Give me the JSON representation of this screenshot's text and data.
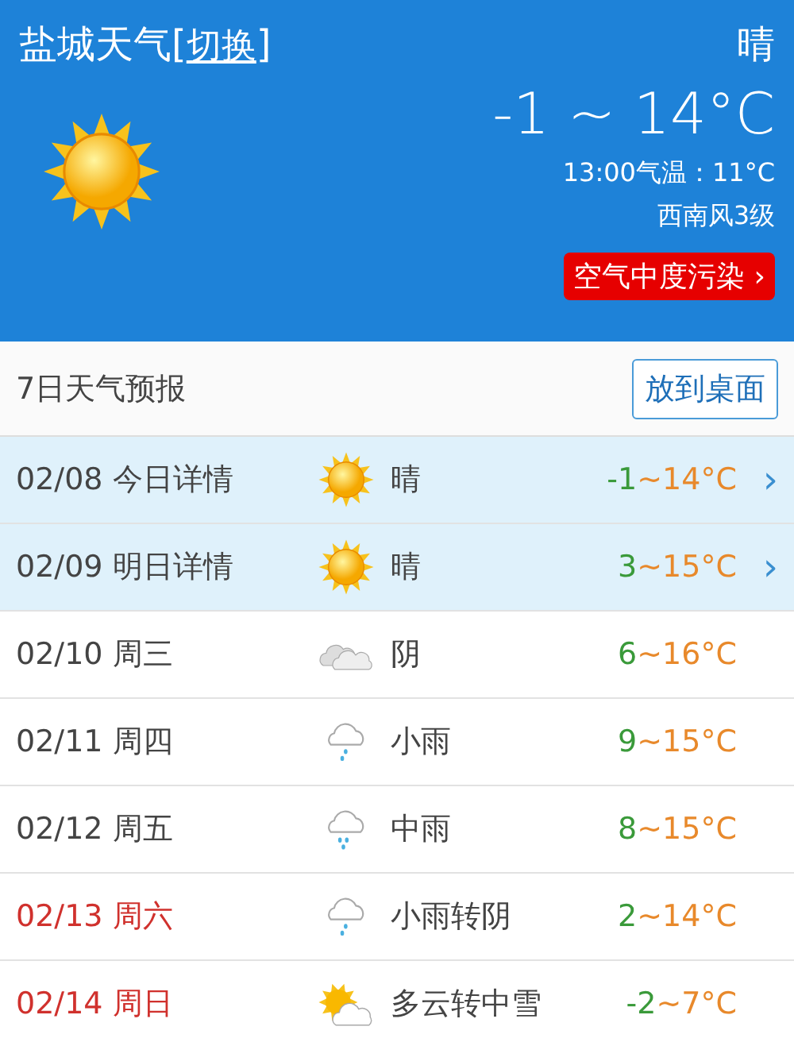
{
  "header": {
    "city": "盐城天气",
    "switch_link": "切换",
    "bracket_open": "[",
    "bracket_close": "]",
    "condition": "晴",
    "kind": "sunny",
    "range": "-1 ~ 14°C",
    "current": "13:00气温：11°C",
    "wind": "西南风3级",
    "air_badge": "空气中度污染",
    "air_chevron": "›"
  },
  "forecast": {
    "title": "7日天气预报",
    "button": "放到桌面",
    "days": [
      {
        "date": "02/08 今日详情",
        "kind": "sunny",
        "condition": "晴",
        "low": "-1",
        "sep": "~",
        "high": "14°C",
        "detail": true,
        "weekend": false,
        "chevron": "›"
      },
      {
        "date": "02/09 明日详情",
        "kind": "sunny",
        "condition": "晴",
        "low": "3",
        "sep": "~",
        "high": "15°C",
        "detail": true,
        "weekend": false,
        "chevron": "›"
      },
      {
        "date": "02/10 周三",
        "kind": "cloudy",
        "condition": "阴",
        "low": "6",
        "sep": "~",
        "high": "16°C",
        "detail": false,
        "weekend": false
      },
      {
        "date": "02/11 周四",
        "kind": "light-rain",
        "condition": "小雨",
        "low": "9",
        "sep": "~",
        "high": "15°C",
        "detail": false,
        "weekend": false
      },
      {
        "date": "02/12 周五",
        "kind": "rain",
        "condition": "中雨",
        "low": "8",
        "sep": "~",
        "high": "15°C",
        "detail": false,
        "weekend": false
      },
      {
        "date": "02/13 周六",
        "kind": "light-rain",
        "condition": "小雨转阴",
        "low": "2",
        "sep": "~",
        "high": "14°C",
        "detail": false,
        "weekend": true
      },
      {
        "date": "02/14 周日",
        "kind": "sun-cloud",
        "condition": "多云转中雪",
        "low": "-2",
        "sep": "~",
        "high": "7°C",
        "detail": false,
        "weekend": true
      }
    ]
  }
}
